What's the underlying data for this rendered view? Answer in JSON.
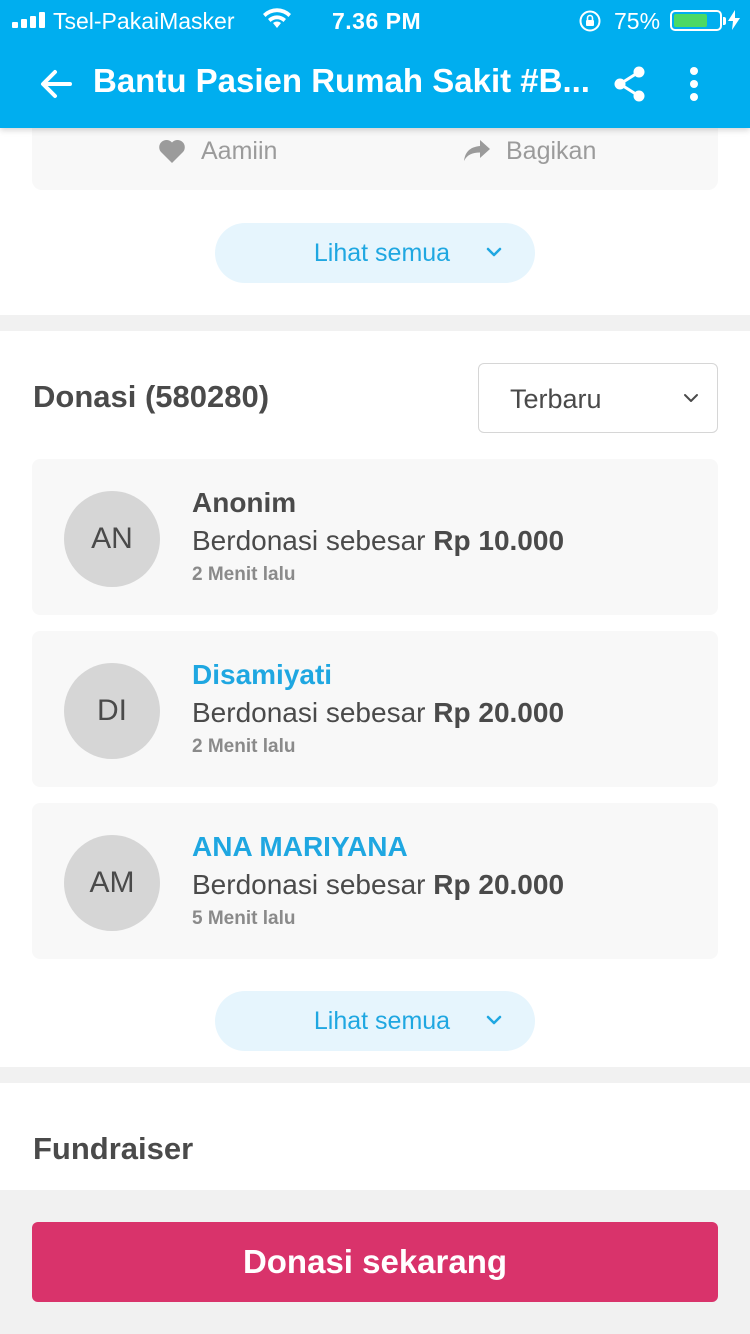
{
  "status_bar": {
    "carrier": "Tsel-PakaiMasker",
    "time": "7.36 PM",
    "battery_percent": "75%",
    "battery_level": 0.75,
    "battery_color": "#4cd964"
  },
  "app_bar": {
    "title": "Bantu Pasien Rumah Sakit #B...",
    "background": "#00AEEF",
    "back_icon": "arrow-left-icon",
    "share_icon": "share-icon",
    "more_icon": "more-vertical-icon"
  },
  "prayer_actions": {
    "amiin_label": "Aamiin",
    "share_label": "Bagikan"
  },
  "see_all_label": "Lihat semua",
  "donations": {
    "title": "Donasi (580280)",
    "sort_selected": "Terbaru",
    "items": [
      {
        "initials": "AN",
        "name": "Anonim",
        "amount_prefix": "Berdonasi sebesar ",
        "amount": "Rp 10.000",
        "time": "2 Menit lalu"
      },
      {
        "initials": "DI",
        "name": "Disamiyati",
        "amount_prefix": "Berdonasi sebesar ",
        "amount": "Rp 20.000",
        "time": "2 Menit lalu"
      },
      {
        "initials": "AM",
        "name": "ANA MARIYANA",
        "amount_prefix": "Berdonasi sebesar ",
        "amount": "Rp 20.000",
        "time": "5 Menit lalu"
      }
    ]
  },
  "fundraiser": {
    "title": "Fundraiser"
  },
  "cta": {
    "label": "Donasi sekarang",
    "color": "#d9336b"
  }
}
